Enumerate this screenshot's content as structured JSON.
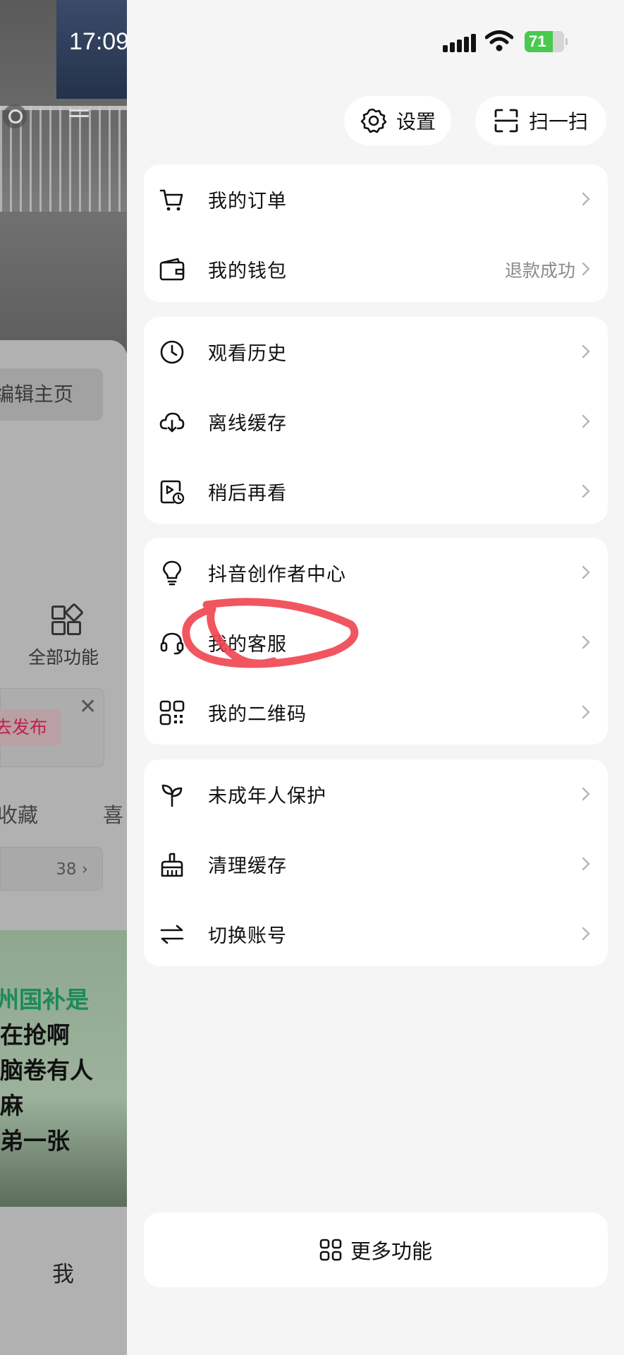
{
  "status_bar": {
    "time": "17:09",
    "battery": "71"
  },
  "background_page": {
    "edit_profile": "编辑主页",
    "all_features": "全部功能",
    "publish": "去发布",
    "tab_favorites": "收藏",
    "tab_likes": "喜",
    "count": "38",
    "thumb_lines": [
      "州国补是",
      "在抢啊",
      "脑卷有人",
      "麻",
      "弟一张"
    ],
    "bottom_tab_me": "我"
  },
  "header": {
    "settings_label": "设置",
    "scan_label": "扫一扫"
  },
  "groups": [
    {
      "items": [
        {
          "label": "我的订单",
          "icon": "cart-icon",
          "extra": ""
        },
        {
          "label": "我的钱包",
          "icon": "wallet-icon",
          "extra": "退款成功"
        }
      ]
    },
    {
      "items": [
        {
          "label": "观看历史",
          "icon": "clock-icon",
          "extra": ""
        },
        {
          "label": "离线缓存",
          "icon": "cloud-download-icon",
          "extra": ""
        },
        {
          "label": "稍后再看",
          "icon": "watch-later-icon",
          "extra": ""
        }
      ]
    },
    {
      "items": [
        {
          "label": "抖音创作者中心",
          "icon": "lightbulb-icon",
          "extra": ""
        },
        {
          "label": "我的客服",
          "icon": "headset-icon",
          "extra": ""
        },
        {
          "label": "我的二维码",
          "icon": "qr-code-icon",
          "extra": ""
        }
      ]
    },
    {
      "items": [
        {
          "label": "未成年人保护",
          "icon": "sprout-icon",
          "extra": ""
        },
        {
          "label": "清理缓存",
          "icon": "broom-icon",
          "extra": ""
        },
        {
          "label": "切换账号",
          "icon": "switch-arrows-icon",
          "extra": ""
        }
      ]
    }
  ],
  "more_label": "更多功能",
  "colors": {
    "annotation_circle": "#f0444f",
    "battery": "#49c94e"
  }
}
